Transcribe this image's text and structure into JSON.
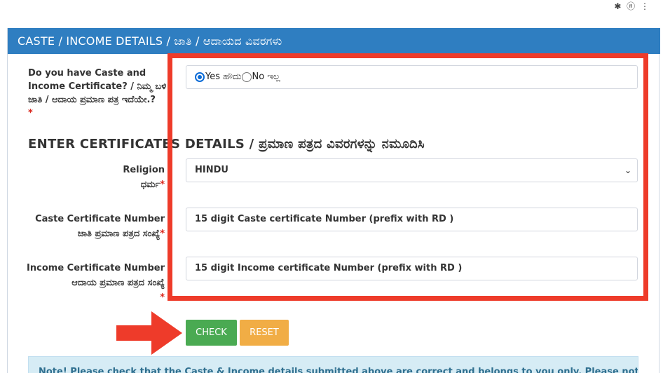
{
  "status_bar": {
    "icons": "✱ ⓝ ⋮"
  },
  "panel": {
    "header": "CASTE / INCOME DETAILS / ಜಾತಿ / ಆದಾಯದ ವಿವರಗಳು"
  },
  "question": {
    "label": "Do you have Caste and Income Certificate? / ನಿಮ್ಮ ಬಳಿ ಜಾತಿ / ಆದಾಯ ಪ್ರಮಾಣ ಪತ್ರ ಇದೆಯೇ.?",
    "required_mark": "*",
    "options": [
      {
        "label": "Yes ಹೌದು",
        "checked": true
      },
      {
        "label": "No ಇಲ್ಲ",
        "checked": false
      }
    ]
  },
  "section_title": "ENTER CERTIFICATES DETAILS / ಪ್ರಮಾಣ ಪತ್ರದ ವಿವರಗಳನ್ನು ನಮೂದಿಸಿ",
  "religion": {
    "label_en": "Religion",
    "label_kn": "ಧರ್ಮ",
    "required_mark": "*",
    "selected": "HINDU",
    "chevron_icon": "chevron-down-icon"
  },
  "caste_certificate": {
    "label_en": "Caste Certificate Number",
    "label_kn": "ಜಾತಿ ಪ್ರಮಾಣ ಪತ್ರದ ಸಂಖ್ಯೆ",
    "required_mark": "*",
    "placeholder": "15 digit Caste certificate Number (prefix with RD )"
  },
  "income_certificate": {
    "label_en": "Income Certificate Number",
    "label_kn": "ಆದಾಯ ಪ್ರಮಾಣ ಪತ್ರದ ಸಂಖ್ಯೆ",
    "required_mark": "*",
    "placeholder": "15 digit Income certificate Number (prefix with RD )"
  },
  "buttons": {
    "check": "CHECK",
    "reset": "RESET"
  },
  "note": "Note! Please check that the Caste & Income details submitted above are correct and belongs to you only. Please note that your",
  "colors": {
    "header_bg": "#2f7ec1",
    "check_bg": "#4aaa52",
    "reset_bg": "#f1ad45",
    "highlight": "#ee3b2a",
    "required": "#d9261c"
  }
}
